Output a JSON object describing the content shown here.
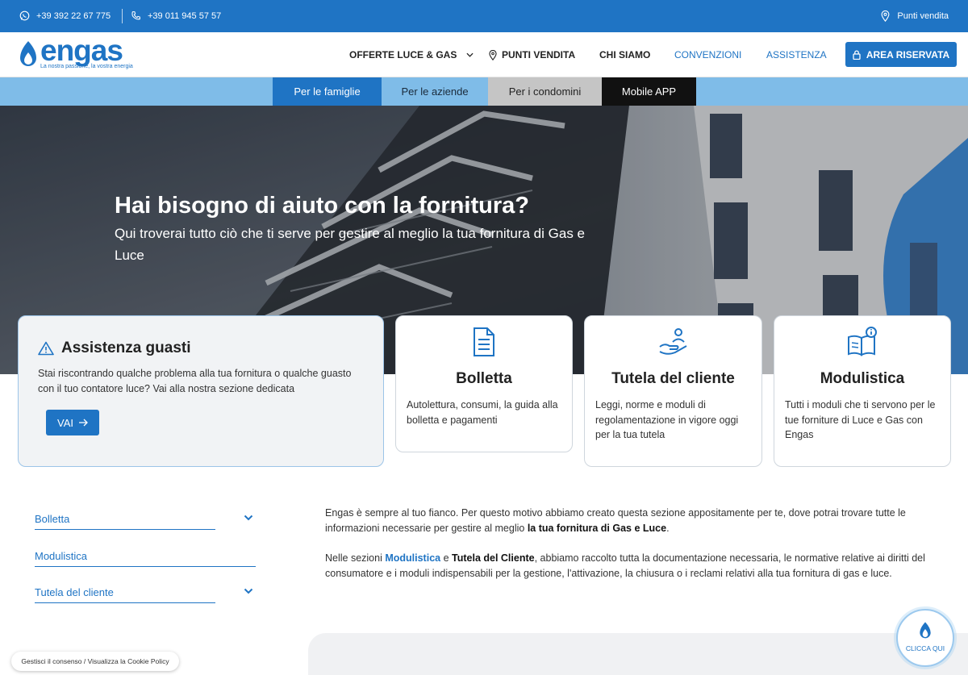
{
  "topbar": {
    "phone_mobile": "+39 392 22 67 775",
    "phone_landline": "+39 011 945 57 57",
    "punti_vendita": "Punti vendita"
  },
  "header": {
    "logo_word": "engas",
    "logo_tagline": "La nostra passione, la vostra energia",
    "nav": {
      "offerte": "OFFERTE LUCE & GAS",
      "punti_vendita": "PUNTI VENDITA",
      "chi_siamo": "CHI SIAMO",
      "convenzioni": "CONVENZIONI",
      "assistenza": "ASSISTENZA"
    },
    "area_riservata": "AREA RISERVATA"
  },
  "segments": [
    "Per le famiglie",
    "Per le aziende",
    "Per i condomini",
    "Mobile APP"
  ],
  "hero": {
    "title": "Hai bisogno di aiuto con la fornitura?",
    "subtitle": "Qui troverai tutto ciò che ti serve per gestire al meglio la tua fornitura di Gas e Luce"
  },
  "assistenza": {
    "title": "Assistenza guasti",
    "text": "Stai riscontrando qualche problema alla tua fornitura o qualche guasto con il tuo contatore luce? Vai alla nostra sezione dedicata",
    "button": "VAI"
  },
  "cards": [
    {
      "title": "Bolletta",
      "desc": "Autolettura, consumi, la guida alla bolletta e pagamenti",
      "icon": "document-icon"
    },
    {
      "title": "Tutela del cliente",
      "desc": "Leggi, norme e moduli di regolamentazione in vigore oggi per la tua tutela",
      "icon": "hand-person-icon"
    },
    {
      "title": "Modulistica",
      "desc": "Tutti i moduli che ti servono per le tue forniture di Luce e Gas con Engas",
      "icon": "book-info-icon"
    }
  ],
  "accordion": [
    "Bolletta",
    "Modulistica",
    "Tutela del cliente"
  ],
  "content": {
    "p1_start": "Engas è sempre al tuo fianco. Per questo motivo abbiamo creato questa sezione appositamente per te, dove potrai trovare tutte le informazioni necessarie per gestire al meglio ",
    "p1_bold": "la tua fornitura di Gas e Luce",
    "p1_end": ".",
    "p2_start": "Nelle sezioni ",
    "p2_link1": "Modulistica",
    "p2_mid": " e ",
    "p2_bold": "Tutela del Cliente",
    "p2_end": ", abbiamo raccolto tutta la documentazione necessaria, le normative relative ai diritti del consumatore e i moduli indispensabili per la gestione, l'attivazione, la chiusura o i reclami relativi alla tua fornitura di gas e luce."
  },
  "cookie": "Gestisci il consenso / Visualizza la Cookie Policy",
  "clicca": "CLICCA QUI",
  "colors": {
    "brand_blue": "#1f74c4",
    "light_blue": "#7fbce8",
    "dark": "#111111"
  }
}
